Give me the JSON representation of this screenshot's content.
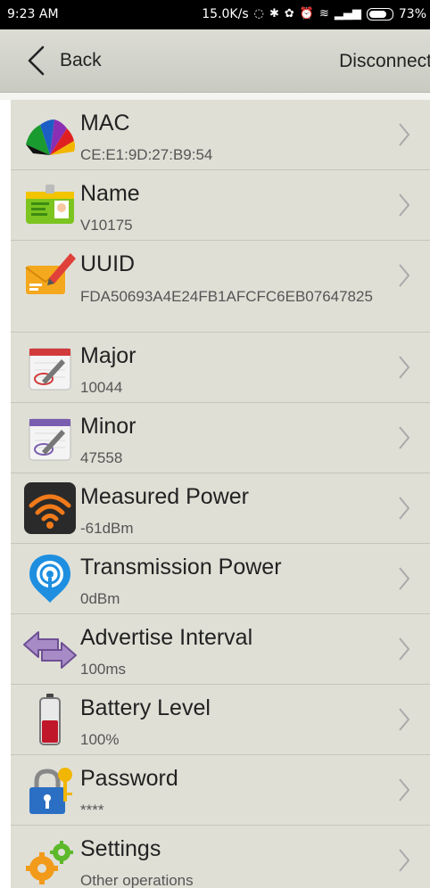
{
  "status_bar": {
    "time": "9:23 AM",
    "speed": "15.0K/s",
    "battery": "73%",
    "icons": [
      "sync-icon",
      "bluetooth-icon",
      "settings-icon",
      "alarm-icon",
      "wifi-icon",
      "signal-icon",
      "battery-icon"
    ]
  },
  "nav": {
    "back_label": "Back",
    "disconnect_label": "Disconnect"
  },
  "items": [
    {
      "title": "MAC",
      "value": "CE:E1:9D:27:B9:54",
      "icon": "color-fan-icon"
    },
    {
      "title": "Name",
      "value": "V10175",
      "icon": "id-card-icon"
    },
    {
      "title": "UUID",
      "value": "FDA50693A4E24FB1AFCFC6EB07647825",
      "icon": "envelope-pen-icon"
    },
    {
      "title": "Major",
      "value": "10044",
      "icon": "calendar-pen-icon"
    },
    {
      "title": "Minor",
      "value": "47558",
      "icon": "calendar-pen-icon"
    },
    {
      "title": "Measured Power",
      "value": "-61dBm",
      "icon": "wifi-icon"
    },
    {
      "title": "Transmission Power",
      "value": "0dBm",
      "icon": "broadcast-icon"
    },
    {
      "title": "Advertise Interval",
      "value": "100ms",
      "icon": "arrows-icon"
    },
    {
      "title": "Battery Level",
      "value": "100%",
      "icon": "battery-icon"
    },
    {
      "title": "Password",
      "value": "****",
      "icon": "lock-key-icon"
    },
    {
      "title": "Settings",
      "value": "Other operations",
      "icon": "gears-icon"
    }
  ]
}
